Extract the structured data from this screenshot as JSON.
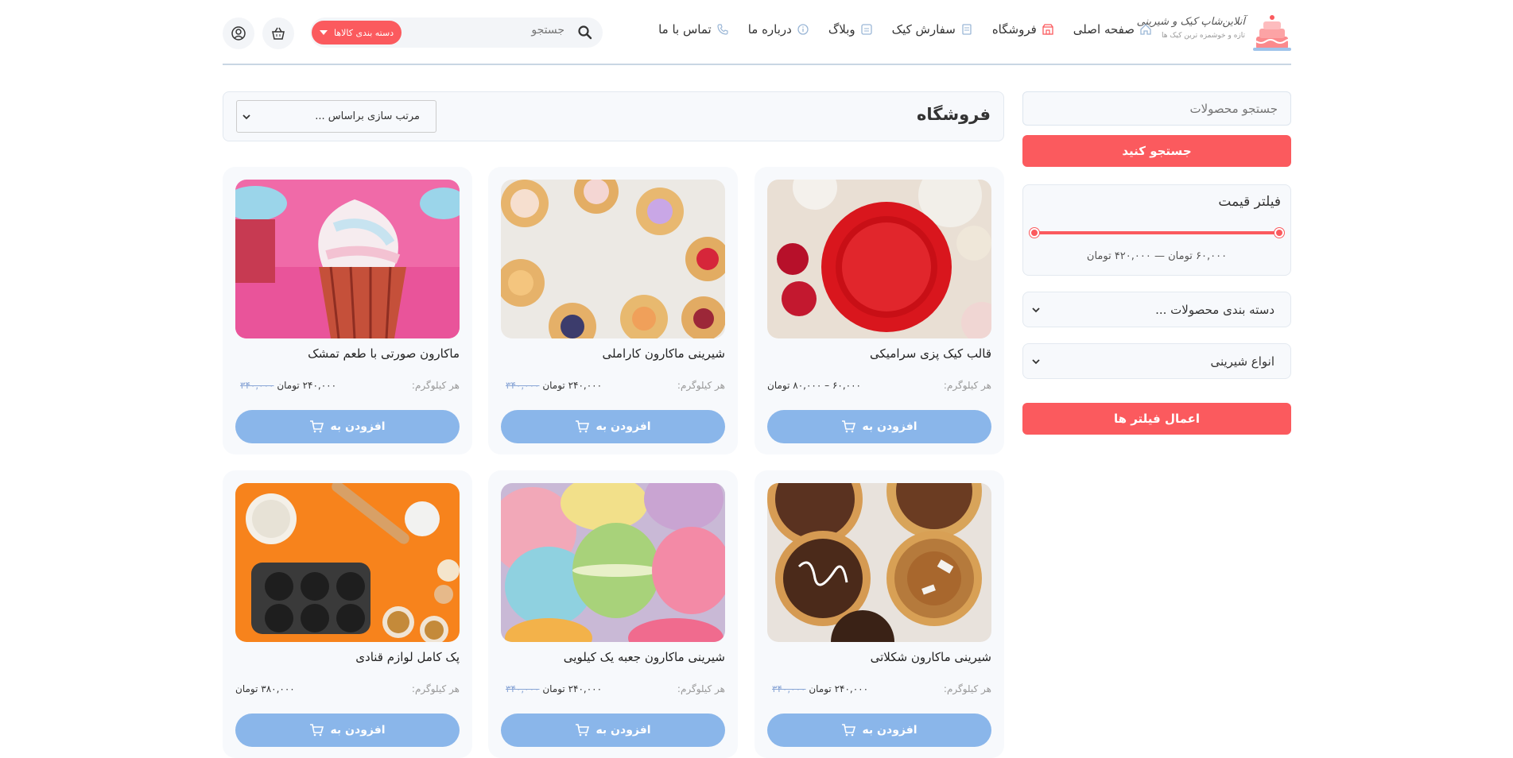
{
  "brand": {
    "name": "آنلاین‌شاپ کیک و شیرینی",
    "tagline": "تازه و خوشمزه ترین کیک ها"
  },
  "nav": [
    {
      "label": "صفحه اصلی",
      "icon": "home-icon"
    },
    {
      "label": "فروشگاه",
      "icon": "store-icon"
    },
    {
      "label": "سفارش کیک",
      "icon": "document-icon"
    },
    {
      "label": "وبلاگ",
      "icon": "note-icon"
    },
    {
      "label": "درباره ما",
      "icon": "info-icon"
    },
    {
      "label": "تماس با ما",
      "icon": "phone-icon"
    }
  ],
  "header": {
    "search_placeholder": "جستجو",
    "category_button": "دسته بندی کالاها"
  },
  "sidebar": {
    "search_placeholder": "جستجو محصولات",
    "search_button": "جستجو کنید",
    "price_filter_title": "فیلتر قیمت",
    "price_range": "۶۰,۰۰۰ تومان — ۴۲۰,۰۰۰ تومان",
    "category_dropdown": "دسته بندی محصولات ...",
    "type_dropdown": "انواع شیرینی",
    "apply_button": "اعمال فیلتر ها"
  },
  "main": {
    "title": "فروشگاه",
    "sort_label": "مرتب سازی براساس ..."
  },
  "products": [
    {
      "name": "قالب کیک پزی سرامیکی",
      "unit": "هر کیلوگرم:",
      "old_price": "",
      "price": "۶۰,۰۰۰ – ۸۰,۰۰۰ تومان",
      "button": "افزودن به"
    },
    {
      "name": "شیرینی ماکارون کاراملی",
      "unit": "هر کیلوگرم:",
      "old_price": "۳۴۰,۰۰۰",
      "price": "۲۴۰,۰۰۰ تومان",
      "button": "افزودن به"
    },
    {
      "name": "ماکارون صورتی با طعم تمشک",
      "unit": "هر کیلوگرم:",
      "old_price": "۳۴۰,۰۰۰",
      "price": "۲۴۰,۰۰۰ تومان",
      "button": "افزودن به"
    },
    {
      "name": "شیرینی ماکارون شکلاتی",
      "unit": "هر کیلوگرم:",
      "old_price": "۳۴۰,۰۰۰",
      "price": "۲۴۰,۰۰۰ تومان",
      "button": "افزودن به"
    },
    {
      "name": "شیرینی ماکارون جعبه یک کیلویی",
      "unit": "هر کیلوگرم:",
      "old_price": "۳۴۰,۰۰۰",
      "price": "۲۴۰,۰۰۰ تومان",
      "button": "افزودن به"
    },
    {
      "name": "پک کامل لوازم قنادی",
      "unit": "هر کیلوگرم:",
      "old_price": "",
      "price": "۳۸۰,۰۰۰ تومان",
      "button": "افزودن به"
    }
  ],
  "colors": {
    "accent": "#fb5a5e",
    "button_blue": "#8ab6ea",
    "panel_bg": "#f7f9fc"
  }
}
